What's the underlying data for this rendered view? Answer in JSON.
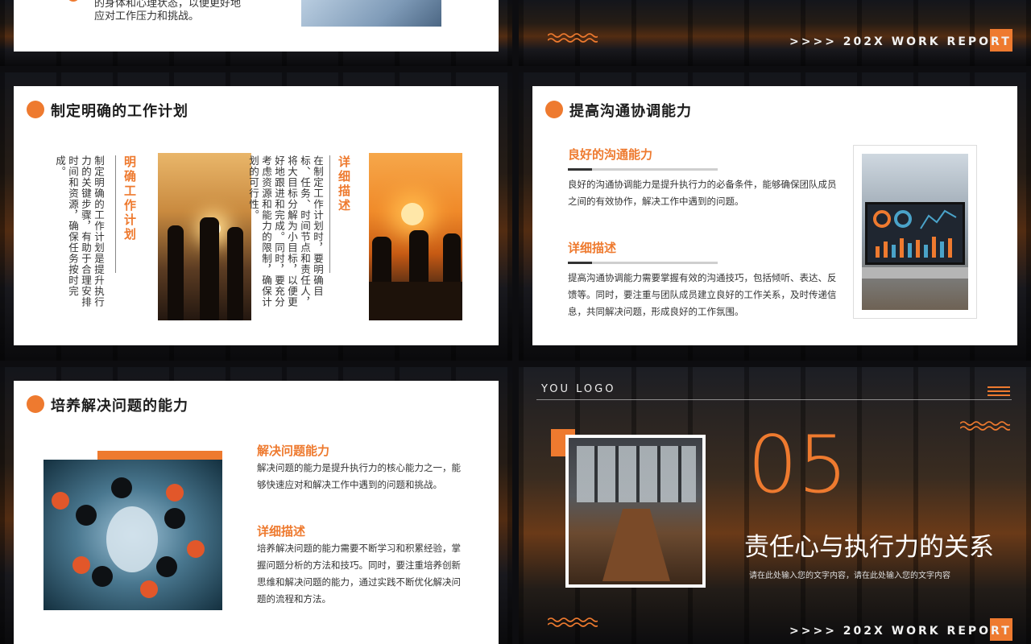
{
  "footer": {
    "text": ">>>> 202X WORK REPORT"
  },
  "slide1": {
    "text_line1": "的身体和心理状态，以便更好地",
    "text_line2": "应对工作压力和挑战。"
  },
  "slide2": {
    "title": "制定明确的工作计划",
    "head1": "明确工作计划",
    "body1": "制定明确的工作计划是提升执行力的关键步骤，有助于合理安排时间和资源，确保任务按时完成。",
    "head2": "详细描述",
    "body2": "在制定工作计划时，要明确目标、任务、时间节点和责任人，将大目标分解为小目标，以便更好地跟进和完成。同时，要充分考虑资源和能力的限制，确保计划的可行性。"
  },
  "slide3": {
    "title": "提高沟通协调能力",
    "head1": "良好的沟通能力",
    "body1": "良好的沟通协调能力是提升执行力的必备条件，能够确保团队成员之间的有效协作，解决工作中遇到的问题。",
    "head2": "详细描述",
    "body2": "提高沟通协调能力需要掌握有效的沟通技巧，包括倾听、表达、反馈等。同时，要注重与团队成员建立良好的工作关系，及时传递信息，共同解决问题，形成良好的工作氛围。"
  },
  "slide4": {
    "title": "培养解决问题的能力",
    "head1": "解决问题能力",
    "body1": "解决问题的能力是提升执行力的核心能力之一，能够快速应对和解决工作中遇到的问题和挑战。",
    "head2": "详细描述",
    "body2": "培养解决问题的能力需要不断学习和积累经验，掌握问题分析的方法和技巧。同时，要注重培养创新思维和解决问题的能力，通过实践不断优化解决问题的流程和方法。"
  },
  "slide5": {
    "logo": "YOU LOGO",
    "number": "05",
    "title": "责任心与执行力的关系",
    "subtitle": "请在此处输入您的文字内容，请在此处输入您的文字内容"
  },
  "colors": {
    "accent": "#ee7a2f",
    "text": "#333333",
    "title": "#1d1d1d"
  },
  "icons": [
    "wave-decoration-icon",
    "menu-lines-icon"
  ]
}
